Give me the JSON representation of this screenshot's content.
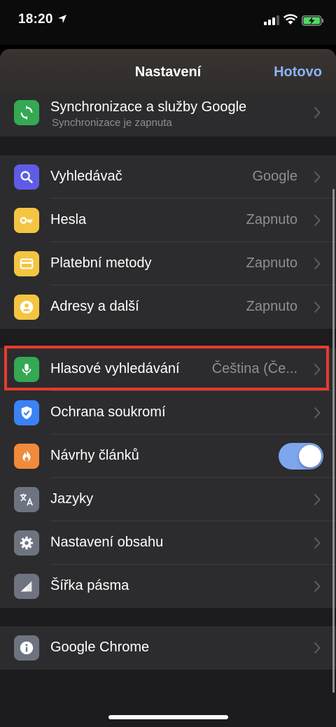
{
  "status": {
    "time": "18:20",
    "location_icon": "location-arrow-icon",
    "signal_icon": "cellular-signal-icon",
    "wifi_icon": "wifi-icon",
    "battery_icon": "battery-charging-icon"
  },
  "header": {
    "title": "Nastavení",
    "done_label": "Hotovo"
  },
  "sync": {
    "label": "Synchronizace a služby Google",
    "sublabel": "Synchronizace je zapnuta",
    "icon": "sync-icon",
    "icon_color": "#34a853"
  },
  "group1": [
    {
      "label": "Vyhledávač",
      "value": "Google",
      "icon": "search-icon",
      "icon_color": "#5e5ce6"
    },
    {
      "label": "Hesla",
      "value": "Zapnuto",
      "icon": "key-icon",
      "icon_color": "#f4c542"
    },
    {
      "label": "Platební metody",
      "value": "Zapnuto",
      "icon": "credit-card-icon",
      "icon_color": "#f4c542"
    },
    {
      "label": "Adresy a další",
      "value": "Zapnuto",
      "icon": "person-icon",
      "icon_color": "#f4c542"
    }
  ],
  "group2": [
    {
      "label": "Hlasové vyhledávání",
      "value": "Čeština (Če...",
      "icon": "microphone-icon",
      "icon_color": "#34a853"
    },
    {
      "label": "Ochrana soukromí",
      "value": "",
      "icon": "shield-icon",
      "icon_color": "#3b82f6"
    },
    {
      "label": "Návrhy článků",
      "toggle_on": true,
      "icon": "fire-icon",
      "icon_color": "#f08a3c"
    },
    {
      "label": "Jazyky",
      "value": "",
      "icon": "translate-icon",
      "icon_color": "#6e7380"
    },
    {
      "label": "Nastavení obsahu",
      "value": "",
      "icon": "gear-icon",
      "icon_color": "#6e7380"
    },
    {
      "label": "Šířka pásma",
      "value": "",
      "icon": "bandwidth-icon",
      "icon_color": "#6e7380"
    }
  ],
  "group3": [
    {
      "label": "Google Chrome",
      "value": "",
      "icon": "info-icon",
      "icon_color": "#6e7380"
    }
  ],
  "colors": {
    "accent": "#8ab4f8",
    "highlight_border": "#e63b2e",
    "toggle_on": "#7ea6ee"
  }
}
